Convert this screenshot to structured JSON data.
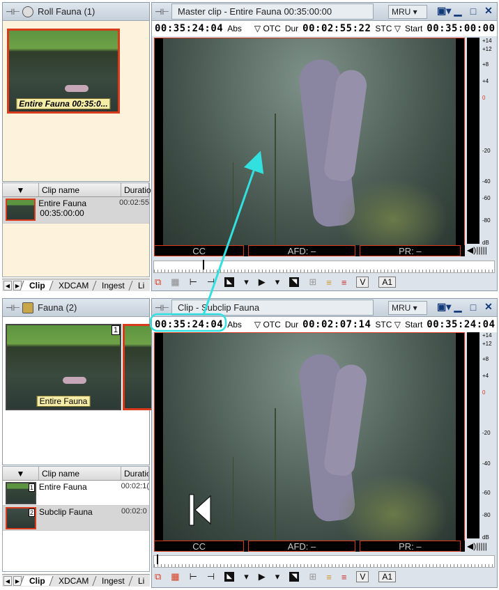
{
  "top_bin": {
    "title": "Roll  Fauna (1)",
    "thumb_label": "Entire Fauna 00:35:0..."
  },
  "top_grid": {
    "headers": [
      "Clip name",
      "Duratio"
    ],
    "rows": [
      {
        "name": "Entire Fauna",
        "tc": "00:35:00:00",
        "dur": "00:02:55"
      }
    ]
  },
  "tabs": [
    "Clip",
    "XDCAM",
    "Ingest",
    "Li"
  ],
  "bottom_bin": {
    "title": "Fauna (2)",
    "thumb_label": "Entire Fauna",
    "thumb_num": "1"
  },
  "bottom_grid": {
    "headers": [
      "Clip name",
      "Duration"
    ],
    "rows": [
      {
        "name": "Entire Fauna",
        "num": "1",
        "dur": "00:02:1("
      },
      {
        "name": "Subclip Fauna",
        "num": "2",
        "dur": "00:02:0"
      }
    ]
  },
  "master_viewer": {
    "title": "Master clip - Entire Fauna 00:35:00:00",
    "mru": "MRU",
    "tc_current": "00:35:24:04",
    "abs": "Abs",
    "otc": "OTC",
    "dur_label": "Dur",
    "tc_dur": "00:02:55:22",
    "stc": "STC",
    "start_label": "Start",
    "tc_start": "00:35:00:00",
    "cc": "CC",
    "afd": "AFD: –",
    "pr": "PR: –"
  },
  "clip_viewer": {
    "title": "Clip - Subclip Fauna",
    "mru": "MRU",
    "tc_current": "00:35:24:04",
    "abs": "Abs",
    "otc": "OTC",
    "dur_label": "Dur",
    "tc_dur": "00:02:07:14",
    "stc": "STC",
    "start_label": "Start",
    "tc_start": "00:35:24:04",
    "cc": "CC",
    "afd": "AFD: –",
    "pr": "PR: –"
  },
  "meter_scale": [
    "+14",
    "+12",
    "+8",
    "+4",
    "0",
    "-20",
    "-40",
    "-60",
    "-80",
    "dB"
  ],
  "controls": {
    "v": "V",
    "a1": "A1"
  },
  "colors": {
    "accent_red": "#d83a1c",
    "callout_cyan": "#33e0e0",
    "bin_bg": "#fdf3dc"
  },
  "icons": [
    "pin-icon",
    "film-reel-icon",
    "trash-bin-icon",
    "mark-in-icon",
    "mark-out-icon",
    "play-icon",
    "volume-icon",
    "snapshot-icon"
  ]
}
